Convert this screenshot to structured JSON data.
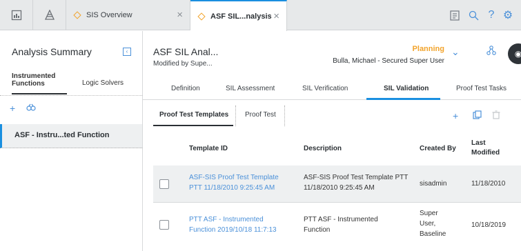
{
  "topbar": {
    "tabs": [
      {
        "label": "SIS Overview",
        "active": false
      },
      {
        "label": "ASF SIL...nalysis",
        "active": true
      }
    ]
  },
  "left_panel": {
    "title": "Analysis Summary",
    "tabs": [
      "Instrumented Functions",
      "Logic Solvers"
    ],
    "items": [
      "ASF - Instru...ted Function"
    ]
  },
  "header": {
    "title": "ASF SIL Anal...",
    "modified_by": "Modified by Supe...",
    "state": "Planning",
    "user": "Bulla, Michael - Secured Super User"
  },
  "subtabs": [
    "Definition",
    "SIL Assessment",
    "SIL Verification",
    "SIL Validation",
    "Proof Test Tasks"
  ],
  "inner_tabs": [
    "Proof Test Templates",
    "Proof Test"
  ],
  "table": {
    "columns": [
      "Template ID",
      "Description",
      "Created By",
      "Last Modified"
    ],
    "rows": [
      {
        "template_id": "ASF-SIS Proof Test Template PTT 11/18/2010 9:25:45 AM",
        "description": "ASF-SIS Proof Test Template PTT 11/18/2010 9:25:45 AM",
        "created_by": "sisadmin",
        "last_modified": "11/18/2010"
      },
      {
        "template_id": "PTT ASF - Instrumented Function 2019/10/18 11:7:13",
        "description": "PTT ASF - Instrumented Function",
        "created_by": "Super User, Baseline",
        "last_modified": "10/18/2019"
      }
    ]
  },
  "colors": {
    "accent": "#1a8fe0",
    "link": "#4a90d9",
    "state": "#f2a32b"
  }
}
